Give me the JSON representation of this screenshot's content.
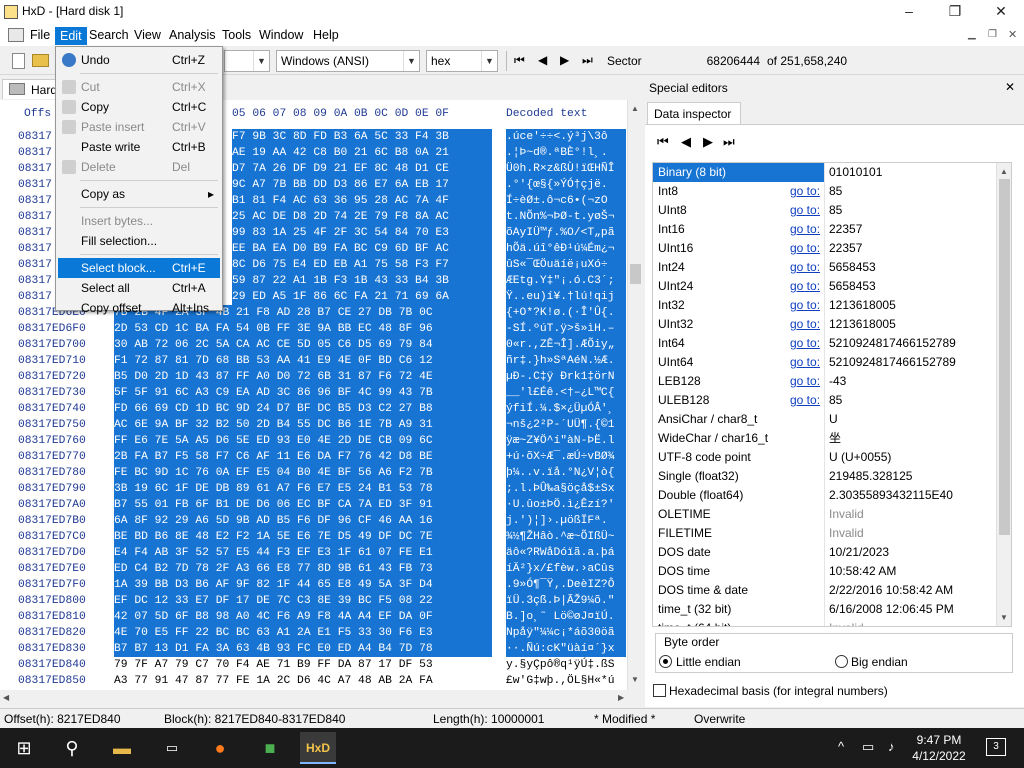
{
  "window": {
    "title": "HxD - [Hard disk 1]",
    "minimize": "–",
    "maximize": "❐",
    "close": "✕"
  },
  "menubar": [
    "File",
    "Edit",
    "Search",
    "View",
    "Analysis",
    "Tools",
    "Window",
    "Help"
  ],
  "toolbar": {
    "charset": "Windows (ANSI)",
    "mode": "hex",
    "sector_label": "Sector",
    "sector_value": "68206444",
    "sector_total": "of 251,658,240"
  },
  "tab": {
    "label": "Hard"
  },
  "hex": {
    "header_offset": "Offs",
    "header_cols": "05 06 07 08 09 0A 0B 0C 0D 0E 0F",
    "header_decoded": "Decoded text",
    "rows": [
      {
        "off": "08317",
        "bytes": "F7 9B 3C 8D FD B3 6A 5C 33 F4 3B",
        "dec": ".úce'÷÷<.ý³j\\3ô",
        "sel": true
      },
      {
        "off": "08317",
        "bytes": "AE 19 AA 42 C8 B0 21 6C B8 0A 21",
        "dec": ".¦Þ~d®.ªBÈ°!l¸.",
        "sel": true
      },
      {
        "off": "08317",
        "bytes": "D7 7A 26 DF D9 21 EF 8C 48 D1 CE",
        "dec": "Ü0h.R×z&ßÙ!ïŒHÑÎ",
        "sel": true
      },
      {
        "off": "08317",
        "bytes": "9C A7 7B BB DD D3 86 E7 6A EB 17",
        "dec": ".°'{œ§{»ÝÓ†çjë.",
        "sel": true
      },
      {
        "off": "08317",
        "bytes": "B1 81 F4 AC 63 36 95 28 AC 7A 4F",
        "dec": "Í÷èØ±.ô¬c6•(¬zO",
        "sel": true
      },
      {
        "off": "08317",
        "bytes": "25 AC DE D8 2D 74 2E 79 F8 8A AC",
        "dec": "t.NÕn%¬ÞØ-t.yøŠ¬",
        "sel": true
      },
      {
        "off": "08317",
        "bytes": "99 83 1A 25 4F 2F 3C 54 84 70 E3",
        "dec": "õAyIÜ™ƒ.%O/<T„pã",
        "sel": true
      },
      {
        "off": "08317",
        "bytes": "EE BA EA D0 B9 FA BC C9 6D BF AC",
        "dec": "hÕä.úî°êÐ¹ú¼Ém¿¬",
        "sel": true
      },
      {
        "off": "08317",
        "bytes": "8C D6 75 E4 ED EB A1 75 58 F3 F7",
        "dec": "ûS«¯ŒÖuäíë¡uXó÷",
        "sel": true
      },
      {
        "off": "08317",
        "bytes": "59 87 22 A1 1B F3 1B 43 33 B4 3B",
        "dec": "ÆEtg.Y‡\"¡.ó.C3´;",
        "sel": true
      },
      {
        "off": "08317",
        "bytes": "29 ED A5 1F 86 6C FA 21 71 69 6A",
        "dec": "Ÿ..eu)í¥.†lú!qij",
        "sel": true
      },
      {
        "off": "08317ED6E0",
        "bytes": "7B 2B 4F 2A 3F 4B 21 F8 AD 28 B7 CE 27 DB 7B 0C",
        "dec": "{+O*?K!ø.(·Î'Û{.",
        "sel": true
      },
      {
        "off": "08317ED6F0",
        "bytes": "2D 53 CD 1C BA FA 54 0B FF 3E 9A BB EC 48 8F 96",
        "dec": "-SÍ.ºúT.ÿ>š»ìH.–",
        "sel": true
      },
      {
        "off": "08317ED700",
        "bytes": "30 AB 72 06 2C 5A CA AC CE 5D 05 C6 D5 69 79 84",
        "dec": "0«r.,ZÊ¬Î].ÆÕiy„",
        "sel": true
      },
      {
        "off": "08317ED710",
        "bytes": "F1 72 87 81 7D 68 BB 53 AA 41 E9 4E 0F BD C6 12",
        "dec": "ñr‡.}h»SªAéN.½Æ.",
        "sel": true
      },
      {
        "off": "08317ED720",
        "bytes": "B5 D0 2D 1D 43 87 FF A0 D0 72 6B 31 87 F6 72 4E",
        "dec": "µÐ-.C‡ÿ Ðrk1‡örN",
        "sel": true
      },
      {
        "off": "08317ED730",
        "bytes": "5F 5F 91 6C A3 C9 EA AD 3C 86 96 BF 4C 99 43 7B",
        "dec": "__'l£Éê.<†–¿L™C{",
        "sel": true
      },
      {
        "off": "08317ED740",
        "bytes": "FD 66 69 CD 1D BC 9D 24 D7 BF DC B5 D3 C2 27 B8",
        "dec": "ýfiÍ.¼.$×¿ÜµÓÂ'¸",
        "sel": true
      },
      {
        "off": "08317ED750",
        "bytes": "AC 6E 9A BF 32 B2 50 2D B4 55 DC B6 1E 7B A9 31",
        "dec": "¬nš¿2²P-´UÜ¶.{©1",
        "sel": true
      },
      {
        "off": "08317ED760",
        "bytes": "FF E6 7E 5A A5 D6 5E ED 93 E0 4E 2D DE CB 09 6C",
        "dec": "ÿæ~Z¥Ö^í\"àN-ÞË.l",
        "sel": true
      },
      {
        "off": "08317ED770",
        "bytes": "2B FA B7 F5 58 F7 C6 AF 11 E6 DA F7 76 42 D8 BE",
        "dec": "+ú·õX÷Æ¯.æÚ÷vBØ¾",
        "sel": true
      },
      {
        "off": "08317ED780",
        "bytes": "FE BC 9D 1C 76 0A EF E5 04 B0 4E BF 56 A6 F2 7B",
        "dec": "þ¼..v.ïå.°N¿V¦ò{",
        "sel": true
      },
      {
        "off": "08317ED790",
        "bytes": "3B 19 6C 1F DE DB 89 61 A7 F6 E7 E5 24 B1 53 78",
        "dec": ";.l.ÞÛ‰a§öçå$±Sx",
        "sel": true
      },
      {
        "off": "08317ED7A0",
        "bytes": "B7 55 01 FB 6F B1 DE D6 06 EC BF CA 7A ED 3F 91",
        "dec": "·U.ûo±ÞÖ.ì¿Êzí?'",
        "sel": true
      },
      {
        "off": "08317ED7B0",
        "bytes": "6A 8F 92 29 A6 5D 9B AD B5 F6 DF 96 CF 46 AA 16",
        "dec": "j.')¦]›.µößÏFª.",
        "sel": true
      },
      {
        "off": "08317ED7C0",
        "bytes": "BE BD B6 8E 48 E2 F2 1A 5E E6 7E D5 49 DF DC 7E",
        "dec": "¾½¶ŽHâò.^æ~ÕIßÜ~",
        "sel": true
      },
      {
        "off": "08317ED7D0",
        "bytes": "E4 F4 AB 3F 52 57 E5 44 F3 EF E3 1F 61 07 FE E1",
        "dec": "äô«?RWåDóïã.a.þá",
        "sel": true
      },
      {
        "off": "08317ED7E0",
        "bytes": "ED C4 B2 7D 78 2F A3 66 E8 77 8D 9B 61 43 FB 73",
        "dec": "íÄ²}x/£fèw.›aCûs",
        "sel": true
      },
      {
        "off": "08317ED7F0",
        "bytes": "1A 39 BB D3 B6 AF 9F 82 1F 44 65 E8 49 5A 3F D4",
        "dec": ".9»Ó¶¯Ÿ‚.DeèIZ?Ô",
        "sel": true
      },
      {
        "off": "08317ED800",
        "bytes": "EF DC 12 33 E7 DF 17 DE 7C C3 8E 39 BC F5 08 22",
        "dec": "ïÜ.3çß.Þ|ÃŽ9¼õ.\"",
        "sel": true
      },
      {
        "off": "08317ED810",
        "bytes": "42 07 5D 6F B8 98 A0 4C F6 A9 F8 4A A4 EF DA 0F",
        "dec": "B.]o¸˜ Lö©øJ¤ïÚ.",
        "sel": true
      },
      {
        "off": "08317ED820",
        "bytes": "4E 70 E5 FF 22 BC BC 63 A1 2A E1 F5 33 30 F6 E3",
        "dec": "Npåÿ\"¼¼c¡*áõ30öã",
        "sel": true
      },
      {
        "off": "08317ED830",
        "bytes": "B7 B7 13 D1 FA 3A 63 4B 93 FC E0 ED A4 B4 7D 78",
        "dec": "··.Ñú:cK\"üàí¤´}x",
        "sel": true
      },
      {
        "off": "08317ED840",
        "bytes": "79 7F A7 79 C7 70 F4 AE 71 B9 FF DA 87 17 DF 53",
        "dec": "y.§yÇpô®q¹ÿÚ‡.ßS",
        "sel": false
      },
      {
        "off": "08317ED850",
        "bytes": "A3 77 91 47 87 77 FE 1A 2C D6 4C A7 48 AB 2A FA",
        "dec": "£w'G‡wþ.,ÖL§H«*ú",
        "sel": false
      }
    ]
  },
  "edit_menu": {
    "items": [
      {
        "label": "Undo",
        "shortcut": "Ctrl+Z",
        "state": "normal",
        "icon": "undo-icon"
      },
      {
        "sep": true
      },
      {
        "label": "Cut",
        "shortcut": "Ctrl+X",
        "state": "disabled",
        "icon": "cut-icon"
      },
      {
        "label": "Copy",
        "shortcut": "Ctrl+C",
        "state": "normal",
        "icon": "copy-icon"
      },
      {
        "label": "Paste insert",
        "shortcut": "Ctrl+V",
        "state": "disabled",
        "icon": "paste-icon"
      },
      {
        "label": "Paste write",
        "shortcut": "Ctrl+B",
        "state": "normal",
        "icon": ""
      },
      {
        "label": "Delete",
        "shortcut": "Del",
        "state": "disabled",
        "icon": "delete-icon"
      },
      {
        "sep": true
      },
      {
        "label": "Copy as",
        "shortcut": "▸",
        "state": "normal",
        "icon": ""
      },
      {
        "sep": true
      },
      {
        "label": "Insert bytes...",
        "shortcut": "",
        "state": "disabled",
        "icon": ""
      },
      {
        "label": "Fill selection...",
        "shortcut": "",
        "state": "normal",
        "icon": ""
      },
      {
        "sep": true
      },
      {
        "label": "Select block...",
        "shortcut": "Ctrl+E",
        "state": "highlight",
        "icon": ""
      },
      {
        "label": "Select all",
        "shortcut": "Ctrl+A",
        "state": "normal",
        "icon": ""
      },
      {
        "label": "Copy offset",
        "shortcut": "Alt+Ins",
        "state": "normal",
        "icon": ""
      }
    ]
  },
  "side": {
    "title": "Special editors",
    "tab": "Data inspector",
    "rows": [
      {
        "name": "Binary (8 bit)",
        "goto": "",
        "value": "01010101",
        "hl": true
      },
      {
        "name": "Int8",
        "goto": "go to:",
        "value": "85"
      },
      {
        "name": "UInt8",
        "goto": "go to:",
        "value": "85"
      },
      {
        "name": "Int16",
        "goto": "go to:",
        "value": "22357"
      },
      {
        "name": "UInt16",
        "goto": "go to:",
        "value": "22357"
      },
      {
        "name": "Int24",
        "goto": "go to:",
        "value": "5658453"
      },
      {
        "name": "UInt24",
        "goto": "go to:",
        "value": "5658453"
      },
      {
        "name": "Int32",
        "goto": "go to:",
        "value": "1213618005"
      },
      {
        "name": "UInt32",
        "goto": "go to:",
        "value": "1213618005"
      },
      {
        "name": "Int64",
        "goto": "go to:",
        "value": "5210924817466152789"
      },
      {
        "name": "UInt64",
        "goto": "go to:",
        "value": "5210924817466152789"
      },
      {
        "name": "LEB128",
        "goto": "go to:",
        "value": "-43"
      },
      {
        "name": "ULEB128",
        "goto": "go to:",
        "value": "85"
      },
      {
        "name": "AnsiChar / char8_t",
        "goto": "",
        "value": "U"
      },
      {
        "name": "WideChar / char16_t",
        "goto": "",
        "value": "坐"
      },
      {
        "name": "UTF-8 code point",
        "goto": "",
        "value": "U (U+0055)"
      },
      {
        "name": "Single (float32)",
        "goto": "",
        "value": "219485.328125"
      },
      {
        "name": "Double (float64)",
        "goto": "",
        "value": "2.30355893432115E40"
      },
      {
        "name": "OLETIME",
        "goto": "",
        "value": "Invalid",
        "gray": true
      },
      {
        "name": "FILETIME",
        "goto": "",
        "value": "Invalid",
        "gray": true
      },
      {
        "name": "DOS date",
        "goto": "",
        "value": "10/21/2023"
      },
      {
        "name": "DOS time",
        "goto": "",
        "value": "10:58:42 AM"
      },
      {
        "name": "DOS time & date",
        "goto": "",
        "value": "2/22/2016 10:58:42 AM"
      },
      {
        "name": "time_t (32 bit)",
        "goto": "",
        "value": "6/16/2008 12:06:45 PM"
      },
      {
        "name": "time_t (64 bit)",
        "goto": "",
        "value": "Invalid",
        "gray": true
      }
    ],
    "byte_order_label": "Byte order",
    "little_endian": "Little endian",
    "big_endian": "Big endian",
    "hex_basis": "Hexadecimal basis (for integral numbers)"
  },
  "status": {
    "offset": "Offset(h): 8217ED840",
    "block": "Block(h): 8217ED840-8317ED840",
    "length": "Length(h): 10000001",
    "modified": "* Modified *",
    "mode": "Overwrite"
  },
  "taskbar": {
    "time": "9:47 PM",
    "date": "4/12/2022",
    "notif_count": "3"
  }
}
